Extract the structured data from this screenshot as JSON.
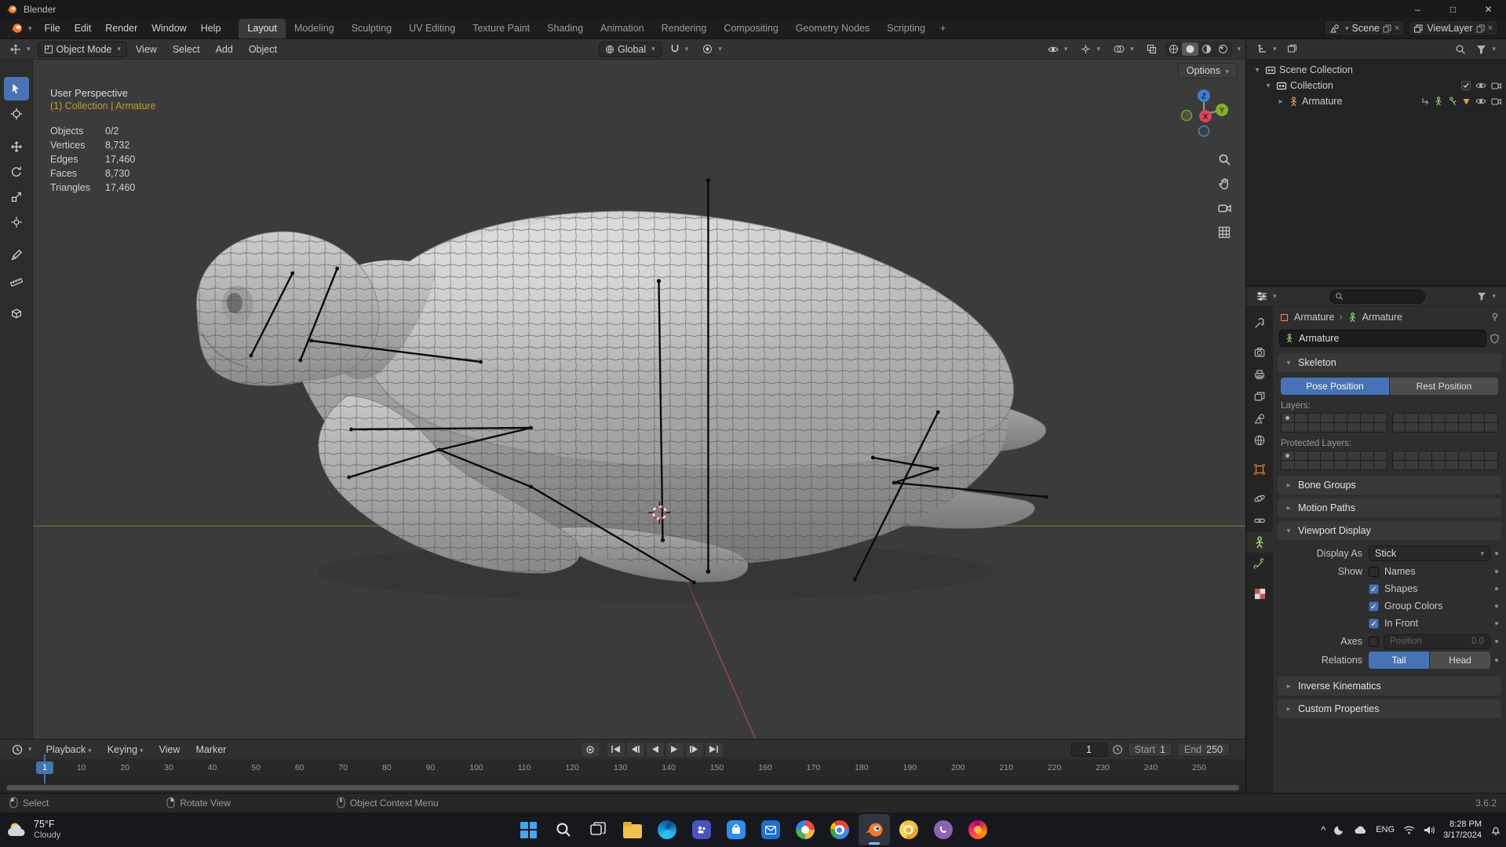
{
  "titlebar": {
    "app_title": "Blender"
  },
  "menubar": {
    "menus": [
      "File",
      "Edit",
      "Render",
      "Window",
      "Help"
    ],
    "workspaces": [
      "Layout",
      "Modeling",
      "Sculpting",
      "UV Editing",
      "Texture Paint",
      "Shading",
      "Animation",
      "Rendering",
      "Compositing",
      "Geometry Nodes",
      "Scripting"
    ],
    "active_workspace": "Layout",
    "new_workspace": "+",
    "scene_name": "Scene",
    "view_layer_name": "ViewLayer"
  },
  "viewport": {
    "header": {
      "mode": "Object Mode",
      "menus": [
        "View",
        "Select",
        "Add",
        "Object"
      ],
      "orientation": "Global",
      "options": "Options"
    },
    "overlay": {
      "view_label": "User Perspective",
      "context_label": "(1) Collection | Armature",
      "stats": [
        {
          "label": "Objects",
          "value": "0/2"
        },
        {
          "label": "Vertices",
          "value": "8,732"
        },
        {
          "label": "Edges",
          "value": "17,460"
        },
        {
          "label": "Faces",
          "value": "8,730"
        },
        {
          "label": "Triangles",
          "value": "17,460"
        }
      ]
    },
    "gizmo": {
      "x": "X",
      "y": "Y",
      "z": "Z"
    }
  },
  "toolbar": {
    "tools": [
      "select-box",
      "cursor",
      "move",
      "rotate",
      "scale",
      "transform",
      "annotate",
      "measure",
      "add-cube"
    ]
  },
  "outliner": {
    "scene_collection": "Scene Collection",
    "collection": "Collection",
    "armature": "Armature"
  },
  "properties": {
    "breadcrumb": {
      "object": "Armature",
      "data": "Armature"
    },
    "name_field": "Armature",
    "skeleton": {
      "title": "Skeleton",
      "pose_position": "Pose Position",
      "rest_position": "Rest Position",
      "layers_label": "Layers:",
      "protected_label": "Protected Layers:"
    },
    "bone_groups": "Bone Groups",
    "motion_paths": "Motion Paths",
    "viewport_display": {
      "title": "Viewport Display",
      "display_as_label": "Display As",
      "display_as_value": "Stick",
      "show_label": "Show",
      "options": [
        {
          "label": "Names",
          "checked": false
        },
        {
          "label": "Shapes",
          "checked": true
        },
        {
          "label": "Group Colors",
          "checked": true
        },
        {
          "label": "In Front",
          "checked": true
        }
      ],
      "axes_label": "Axes",
      "position_label": "Position",
      "position_value": "0.0",
      "relations_label": "Relations",
      "tail": "Tail",
      "head": "Head"
    },
    "inverse_kinematics": "Inverse Kinematics",
    "custom_properties": "Custom Properties"
  },
  "timeline": {
    "menus": [
      "Playback",
      "Keying",
      "View",
      "Marker"
    ],
    "current_frame": "1",
    "start_label": "Start",
    "start_value": "1",
    "end_label": "End",
    "end_value": "250",
    "ruler": [
      "1",
      "10",
      "20",
      "30",
      "40",
      "50",
      "60",
      "70",
      "80",
      "90",
      "100",
      "110",
      "120",
      "130",
      "140",
      "150",
      "160",
      "170",
      "180",
      "190",
      "200",
      "210",
      "220",
      "230",
      "240",
      "250"
    ]
  },
  "statusbar": {
    "hints": [
      "Select",
      "Rotate View",
      "Object Context Menu"
    ],
    "version": "3.6.2"
  },
  "taskbar": {
    "weather": {
      "temp": "75°F",
      "condition": "Cloudy"
    },
    "apps": [
      "start",
      "search",
      "task-view",
      "file-explorer",
      "edge",
      "teams",
      "store",
      "outlook",
      "photos",
      "chrome",
      "blender",
      "chrome-canary",
      "viber",
      "firefox"
    ],
    "tray": {
      "language": "ENG",
      "time": "8:28 PM",
      "date": "3/17/2024"
    }
  }
}
